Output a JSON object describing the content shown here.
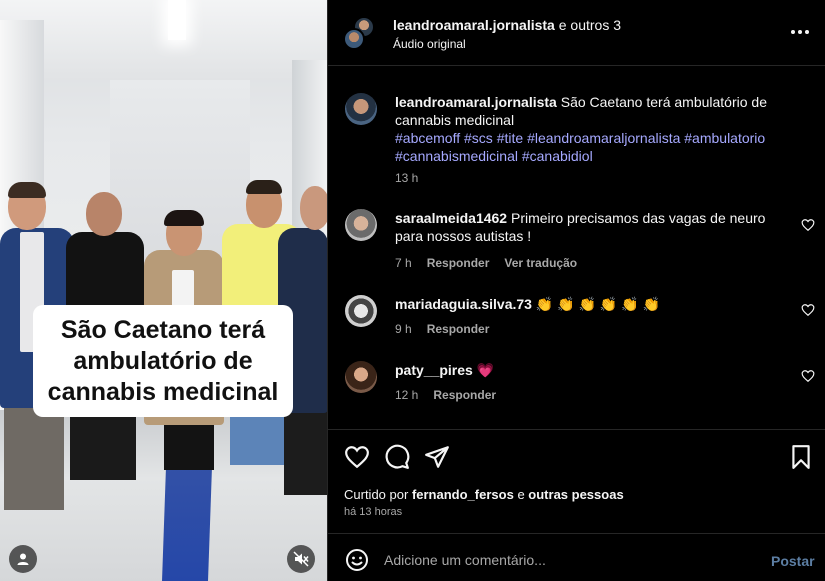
{
  "video": {
    "caption_overlay": "São Caetano terá ambulatório de cannabis medicinal"
  },
  "header": {
    "username": "leandroamaral.jornalista",
    "coauthors": "e outros 3",
    "audio": "Áudio original"
  },
  "post_caption": {
    "username": "leandroamaral.jornalista",
    "text": "São Caetano terá ambulatório de cannabis medicinal",
    "hashtags": [
      "#abcemoff",
      "#scs",
      "#tite",
      "#leandroamaraljornalista",
      "#ambulatorio",
      "#cannabismedicinal",
      "#canabidiol"
    ],
    "time": "13 h"
  },
  "comments": [
    {
      "username": "saraalmeida1462",
      "text": "Primeiro precisamos das vagas de neuro para nossos autistas !",
      "time": "7 h",
      "reply": "Responder",
      "translate": "Ver tradução"
    },
    {
      "username": "mariadaguia.silva.73",
      "text": "👏 👏 👏 👏 👏 👏",
      "time": "9 h",
      "reply": "Responder"
    },
    {
      "username": "paty__pires",
      "text": "💗",
      "time": "12 h",
      "reply": "Responder"
    }
  ],
  "likes": {
    "prefix": "Curtido por",
    "user": "fernando_fersos",
    "connector": "e",
    "others": "outras pessoas",
    "ago": "há 13 horas"
  },
  "compose": {
    "placeholder": "Adicione um comentário...",
    "post_label": "Postar"
  },
  "colors": {
    "background": "#000000",
    "hashtag": "#a6a9ff",
    "muted": "#a8a8a8",
    "post_button": "#5c7ea3",
    "heart": "#ff3d77"
  }
}
